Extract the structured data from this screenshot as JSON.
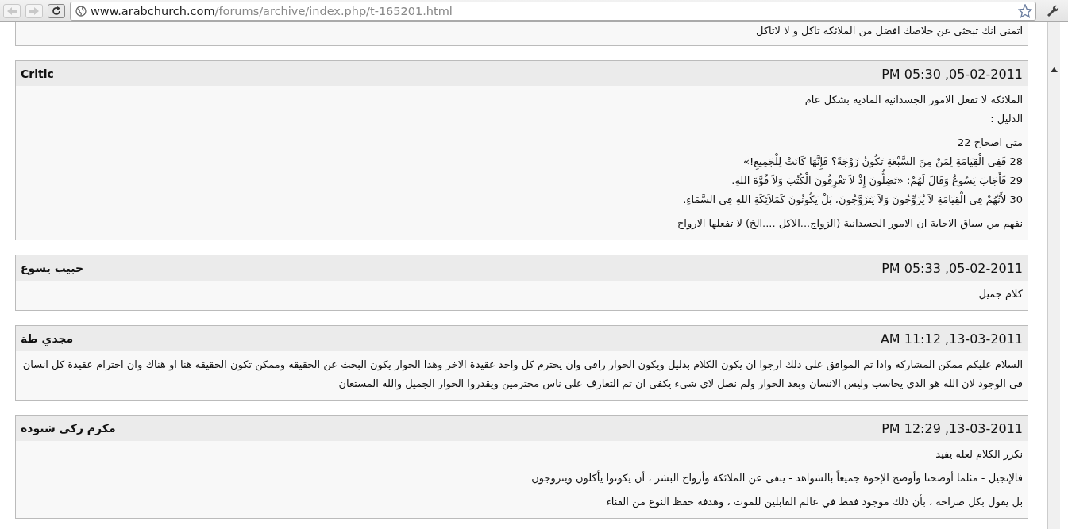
{
  "browser": {
    "url_host": "www.arabchurch.com",
    "url_path": "/forums/archive/index.php/t-165201.html"
  },
  "partial_post": {
    "body": "اتمنى انك تبحثى عن خلاصك افضل من الملائكه تاكل و لا لاتاكل"
  },
  "posts": [
    {
      "username": "Critic",
      "date": "PM 05:30 ,05-02-2011",
      "paragraphs": [
        [
          "الملائكة لا تفعل الامور الجسدانية المادية بشكل عام",
          "الدليل :"
        ],
        [
          "متى اصحاح 22",
          "28 فَفِي الْقِيَامَةِ لِمَنْ مِنَ السَّبْعَةِ تَكُونُ زَوْجَةً؟ فَإِنَّهَا كَانَتْ لِلْجَمِيعِ!»",
          "29 فَأَجَابَ يَسُوعُ وَقَالَ لَهُمْ: «تَضِلُّونَ إِذْ لاَ تَعْرِفُونَ الْكُتُبَ وَلاَ قُوَّةَ اللهِ.",
          "30 لأَنَّهُمْ فِي الْقِيَامَةِ لاَ يُزَوِّجُونَ وَلاَ يَتَزَوَّجُونَ، بَلْ يَكُونُونَ كَمَلاَئِكَةِ اللهِ فِي السَّمَاءِ."
        ],
        [
          "نفهم من سياق الاجابة ان الامور الجسدانية (الزواج...الاكل ....الخ) لا تفعلها الارواح"
        ]
      ]
    },
    {
      "username": "حبيب يسوع",
      "date": "PM 05:33 ,05-02-2011",
      "paragraphs": [
        [
          "كلام جميل"
        ]
      ]
    },
    {
      "username": "مجدي طة",
      "date": "AM 11:12 ,13-03-2011",
      "paragraphs": [
        [
          "السلام عليكم ممكن المشاركه واذا تم الموافق علي ذلك ارجوا ان يكون الكلام بدليل ويكون الحوار راقي وان يحترم كل واحد عقيدة الاخر وهذا الحوار يكون البحث عن الحقيقه وممكن تكون الحقيقه هنا او هناك وان احترام عقيدة كل انسان في الوجود لان الله هو الذي يحاسب وليس الانسان وبعد الحوار ولم نصل لاي شيء يكفي ان تم التعارف علي ناس محترمين ويقدروا الحوار الجميل والله المستعان"
        ]
      ]
    },
    {
      "username": "مكرم زكى شنوده",
      "date": "PM 12:29 ,13-03-2011",
      "paragraphs": [
        [
          "نكرر الكلام لعله يفيد"
        ],
        [
          "فالإنجيل - مثلما أوضحنا وأوضح الإخوة جميعاً بالشواهد - ينفى عن الملائكة وأرواح البشر ، أن يكونوا يأكلون ويتزوجون"
        ],
        [
          "بل يقول بكل صراحة ، بأن ذلك موجود فقط في عالم القابلين للموت ، وهدفه حفظ النوع من الفناء"
        ]
      ]
    }
  ]
}
